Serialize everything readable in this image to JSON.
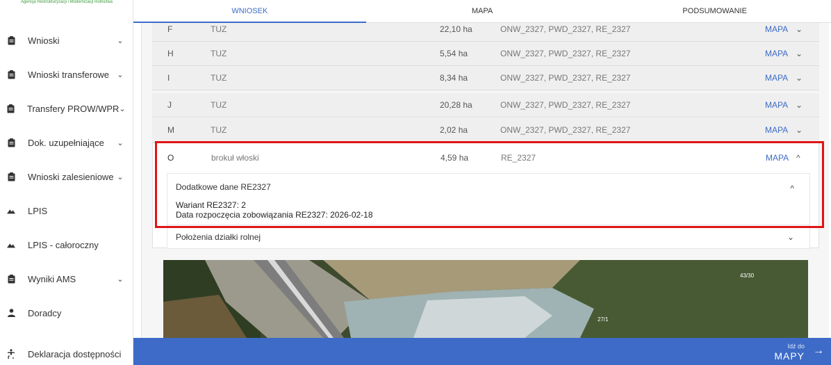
{
  "agency_text": "Agencja Restrukturyzacji i Modernizacji Rolnictwa",
  "tabs": [
    "WNIOSEK",
    "MAPA",
    "PODSUMOWANIE"
  ],
  "sidebar": {
    "items": [
      {
        "label": "Wnioski",
        "icon": "clipboard-icon",
        "chevron": "⌄"
      },
      {
        "label": "Wnioski transferowe",
        "icon": "clipboard-icon",
        "chevron": "⌄"
      },
      {
        "label": "Transfery PROW/WPR",
        "icon": "clipboard-icon",
        "chevron": "⌄"
      },
      {
        "label": "Dok. uzupełniające",
        "icon": "clipboard-icon",
        "chevron": "⌄"
      },
      {
        "label": "Wnioski zalesieniowe",
        "icon": "clipboard-icon",
        "chevron": "⌄"
      },
      {
        "label": "LPIS",
        "icon": "mountain-icon",
        "chevron": ""
      },
      {
        "label": "LPIS - całoroczny",
        "icon": "mountain-icon",
        "chevron": ""
      },
      {
        "label": "Wyniki AMS",
        "icon": "clipboard-icon",
        "chevron": "⌄"
      },
      {
        "label": "Doradcy",
        "icon": "person-icon",
        "chevron": ""
      },
      {
        "label": "Deklaracja dostępności",
        "icon": "accessibility-icon",
        "chevron": ""
      }
    ]
  },
  "rows": [
    {
      "letter": "F",
      "crop": "TUZ",
      "area": "22,10 ha",
      "codes": "ONW_2327, PWD_2327, RE_2327",
      "map": "MAPA",
      "chevron": "⌄"
    },
    {
      "letter": "H",
      "crop": "TUZ",
      "area": "5,54 ha",
      "codes": "ONW_2327, PWD_2327, RE_2327",
      "map": "MAPA",
      "chevron": "⌄"
    },
    {
      "letter": "I",
      "crop": "TUZ",
      "area": "8,34 ha",
      "codes": "ONW_2327, PWD_2327, RE_2327",
      "map": "MAPA",
      "chevron": "⌄"
    },
    {
      "letter": "J",
      "crop": "TUZ",
      "area": "20,28 ha",
      "codes": "ONW_2327, PWD_2327, RE_2327",
      "map": "MAPA",
      "chevron": "⌄"
    },
    {
      "letter": "M",
      "crop": "TUZ",
      "area": "2,02 ha",
      "codes": "ONW_2327, PWD_2327, RE_2327",
      "map": "MAPA",
      "chevron": "⌄"
    }
  ],
  "expanded": {
    "letter": "O",
    "crop": "brokuł włoski",
    "area": "4,59 ha",
    "codes": "RE_2327",
    "map": "MAPA",
    "chevron": "^",
    "details_title": "Dodatkowe dane RE2327",
    "details_chevron": "^",
    "wariant": "Wariant RE2327: 2",
    "data_rozpoczecia": "Data rozpoczęcia zobowiązania RE2327: 2026-02-18",
    "polozenia": "Położenia działki rolnej",
    "polozenia_chevron": "⌄"
  },
  "map_labels": [
    "43/30",
    "27/1"
  ],
  "goto": {
    "small": "Idź do",
    "big": "MAPY",
    "arrow": "→"
  },
  "colors": {
    "accent": "#3d6bc7",
    "highlight": "#e01414"
  }
}
